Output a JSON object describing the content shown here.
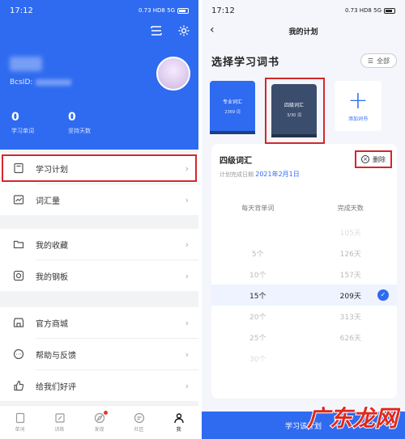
{
  "left": {
    "status": {
      "time": "17:12",
      "signal": "0.73 HD8 5G"
    },
    "header": {
      "user_id_prefix": "BcsID:",
      "stats": [
        {
          "num": "0",
          "label": "学习单词"
        },
        {
          "num": "0",
          "label": "坚持天数"
        }
      ]
    },
    "menu_groups": [
      {
        "items": [
          {
            "label": "学习计划",
            "icon": "book-icon",
            "highlighted": true
          },
          {
            "label": "词汇量",
            "icon": "chart-icon"
          }
        ]
      },
      {
        "items": [
          {
            "label": "我的收藏",
            "icon": "folder-icon"
          },
          {
            "label": "我的钢板",
            "icon": "circle-icon"
          }
        ]
      },
      {
        "items": [
          {
            "label": "官方商城",
            "icon": "store-icon"
          },
          {
            "label": "帮助与反馈",
            "icon": "chat-icon"
          },
          {
            "label": "给我们好评",
            "icon": "thumb-icon"
          }
        ]
      }
    ],
    "chevron": "›",
    "bottom_nav": [
      {
        "label": "单词",
        "icon": "book-nav-icon"
      },
      {
        "label": "训练",
        "icon": "pencil-nav-icon"
      },
      {
        "label": "发现",
        "icon": "compass-nav-icon",
        "badge": true
      },
      {
        "label": "社区",
        "icon": "bubble-nav-icon"
      },
      {
        "label": "我",
        "icon": "person-nav-icon",
        "active": true
      }
    ]
  },
  "right": {
    "status": {
      "time": "17:12",
      "signal": "0.73 HD8 5G"
    },
    "title": "我的计划",
    "section_title": "选择学习词书",
    "all_label": "全部",
    "books": [
      {
        "title": "专业词汇",
        "count": "2369 词"
      },
      {
        "title": "四级词汇",
        "count": "3/30 词",
        "selected": true
      }
    ],
    "add_book_label": "添加词书",
    "card": {
      "title": "四级词汇",
      "sub_prefix": "计划完成日期",
      "date": "2021年2月1日",
      "delete_label": "删除",
      "col_heads": [
        "每天背单词",
        "完成天数"
      ],
      "rows": [
        {
          "words": "",
          "days": "105天",
          "state": "faint"
        },
        {
          "words": "5个",
          "days": "126天",
          "state": ""
        },
        {
          "words": "10个",
          "days": "157天",
          "state": ""
        },
        {
          "words": "15个",
          "days": "209天",
          "state": "sel"
        },
        {
          "words": "20个",
          "days": "313天",
          "state": ""
        },
        {
          "words": "25个",
          "days": "626天",
          "state": ""
        },
        {
          "words": "30个",
          "days": "",
          "state": "faint"
        }
      ]
    },
    "confirm_label": "学习该计划"
  },
  "colors": {
    "accent": "#2f6bf0",
    "highlight": "#d4272c",
    "watermark": "#e0281d"
  },
  "watermark_text": "广东龙网"
}
